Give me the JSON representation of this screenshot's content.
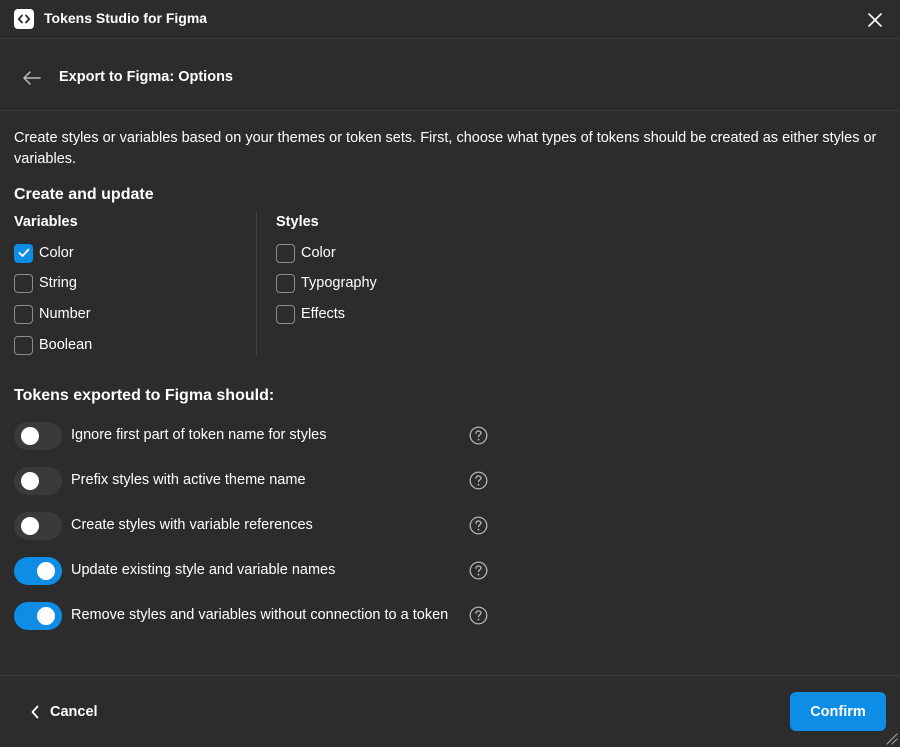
{
  "window": {
    "title": "Tokens Studio for Figma",
    "logo_icon": "code-brackets-icon",
    "close_icon": "close-icon"
  },
  "header": {
    "back_icon": "arrow-left-icon",
    "title": "Export to Figma: Options"
  },
  "description": "Create styles or variables based on your themes or token sets. First, choose what types of tokens should be created as either styles or variables.",
  "create_update": {
    "title": "Create and update",
    "variables": {
      "title": "Variables",
      "items": [
        {
          "label": "Color",
          "checked": true
        },
        {
          "label": "String",
          "checked": false
        },
        {
          "label": "Number",
          "checked": false
        },
        {
          "label": "Boolean",
          "checked": false
        }
      ]
    },
    "styles": {
      "title": "Styles",
      "items": [
        {
          "label": "Color",
          "checked": false
        },
        {
          "label": "Typography",
          "checked": false
        },
        {
          "label": "Effects",
          "checked": false
        }
      ]
    }
  },
  "export_options": {
    "title": "Tokens exported to Figma should:",
    "items": [
      {
        "label": "Ignore first part of token name for styles",
        "on": false
      },
      {
        "label": "Prefix styles with active theme name",
        "on": false
      },
      {
        "label": "Create styles with variable references",
        "on": false
      },
      {
        "label": "Update existing style and variable names",
        "on": true
      },
      {
        "label": "Remove styles and variables without connection to a token",
        "on": true
      }
    ]
  },
  "footer": {
    "cancel_label": "Cancel",
    "confirm_label": "Confirm"
  },
  "colors": {
    "background": "#2c2c2c",
    "accent": "#0d8de6",
    "toggle_off": "#3a3a3a",
    "border": "#3d3d3d"
  }
}
